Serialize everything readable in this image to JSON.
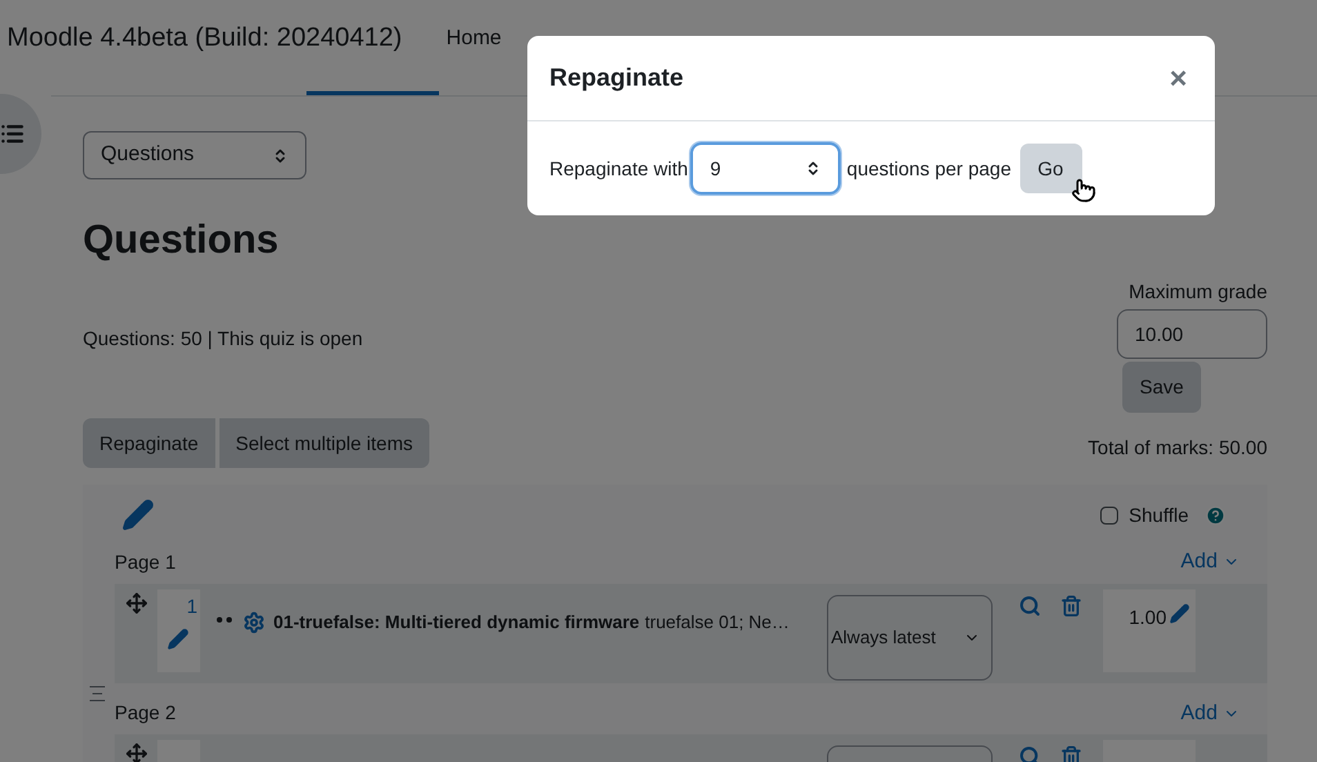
{
  "header": {
    "site_name": "Moodle 4.4beta (Build: 20240412)",
    "nav": [
      {
        "label": "Home",
        "selected": false
      }
    ]
  },
  "section_select": {
    "value": "Questions"
  },
  "heading": "Questions",
  "info": "Questions: 50 | This quiz is open",
  "max_grade": {
    "label": "Maximum grade",
    "value": "10.00",
    "button": "Save"
  },
  "actions": [
    "Repaginate",
    "Select multiple items"
  ],
  "total": "Total of marks: 50.00",
  "shuffle": {
    "label": "Shuffle",
    "checked": false
  },
  "pages": [
    {
      "label": "Page 1",
      "add": "Add",
      "questions": [
        {
          "kind": "question",
          "number": "1",
          "title": "01-truefalse: Multi-tiered dynamic firmware",
          "text": "truefalse 01; Ne…",
          "version": "Always latest",
          "mark": "1.00"
        }
      ]
    },
    {
      "label": "Page 2",
      "add": "Add",
      "questions": [
        {
          "kind": "partial"
        }
      ]
    }
  ],
  "dialog": {
    "title": "Repaginate",
    "close": "×",
    "prefix": "Repaginate with",
    "value": "9",
    "suffix": "questions per page",
    "button": "Go"
  }
}
